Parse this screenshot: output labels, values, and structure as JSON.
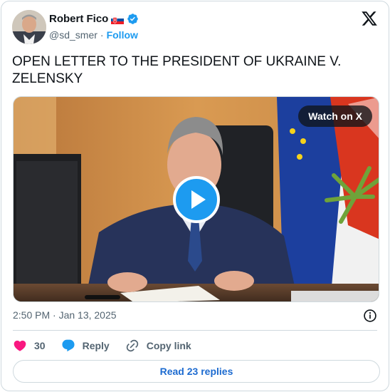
{
  "author": {
    "name": "Robert Fico",
    "handle": "@sd_smer",
    "separator": "·",
    "follow_label": "Follow"
  },
  "icons": {
    "flag": "slovakia-flag-icon",
    "verified": "verified-badge-icon",
    "brand": "x-logo-icon",
    "play": "play-icon",
    "info": "info-icon",
    "like": "heart-icon",
    "reply": "reply-bubble-icon",
    "copy": "link-icon"
  },
  "tweet": {
    "text": "OPEN LETTER TO THE PRESIDENT OF UKRAINE V. ZELENSKY",
    "timestamp": "2:50 PM · Jan 13, 2025"
  },
  "media": {
    "watch_label": "Watch on X"
  },
  "actions": {
    "like_count": "30",
    "reply_label": "Reply",
    "copy_label": "Copy link"
  },
  "footer": {
    "read_replies_label": "Read 23 replies"
  },
  "colors": {
    "accent": "#1d9bf0",
    "like": "#f91880",
    "link": "#1d6bd0",
    "text_secondary": "#536471",
    "border": "#cfd9de"
  }
}
